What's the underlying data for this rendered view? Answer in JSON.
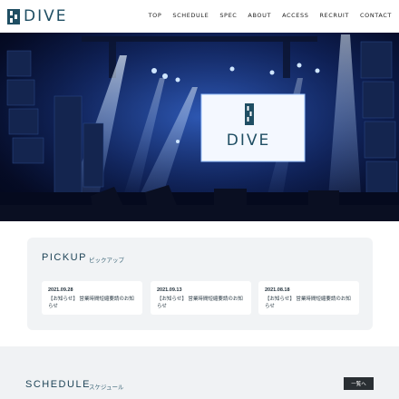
{
  "header": {
    "logo_text": "DIVE",
    "nav": [
      "TOP",
      "SCHEDULE",
      "SPEC",
      "ABOUT",
      "ACCESS",
      "RECRUIT",
      "CONTACT"
    ]
  },
  "hero": {
    "screen_logo_text": "DIVE"
  },
  "pickup": {
    "title": "PICKUP",
    "subtitle": "ピックアップ",
    "cards": [
      {
        "date": "2021.09.28",
        "text": "【お知らせ】 営業時間短縮要請のお知らせ"
      },
      {
        "date": "2021.09.13",
        "text": "【お知らせ】 営業時間短縮要請のお知らせ"
      },
      {
        "date": "2021.08.18",
        "text": "【お知らせ】 営業時間短縮要請のお知らせ"
      }
    ]
  },
  "schedule": {
    "title": "SCHEDULE",
    "subtitle": "スケジュール",
    "button": "一覧へ"
  },
  "colors": {
    "brand": "#1f4e63",
    "hero_dark": "#050b24",
    "stage_blue": "#1f3f8f",
    "panel_bg": "#f1f3f5",
    "button_bg": "#2a2f33"
  }
}
